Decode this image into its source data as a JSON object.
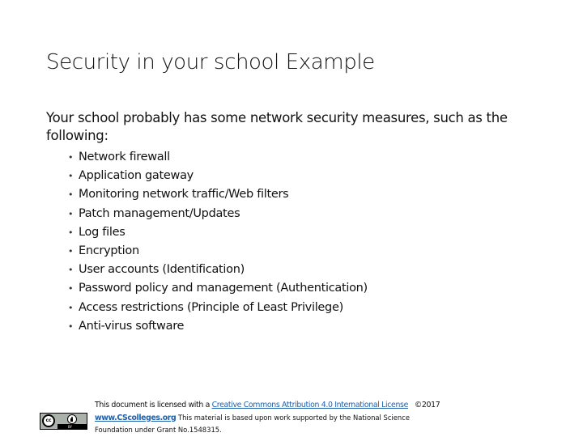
{
  "slide": {
    "title": "Security in your school Example",
    "intro": "Your school probably has some network security measures, such as the following:",
    "bullet_glyph": "•",
    "bullets": [
      "Network firewall",
      "Application gateway",
      "Monitoring network traffic/Web filters",
      "Patch management/Updates",
      "Log files",
      "Encryption",
      "User accounts (Identification)",
      "Password policy and management (Authentication)",
      "Access restrictions (Principle of Least Privilege)",
      "Anti-virus software"
    ]
  },
  "footer": {
    "badge": {
      "icon": "creative-commons-by-icon",
      "cc_label": "cc",
      "by_label": "BY"
    },
    "line1_prefix": "This document is licensed with a ",
    "license_link": "Creative Commons Attribution 4.0 International License",
    "copyright": "©2017",
    "site_link": "www.CScolleges.org",
    "line2_suffix": " This material is based upon work supported by the National Science",
    "line3": "Foundation under Grant No.1548315.",
    "colors": {
      "link": "#1f5fa8"
    }
  }
}
